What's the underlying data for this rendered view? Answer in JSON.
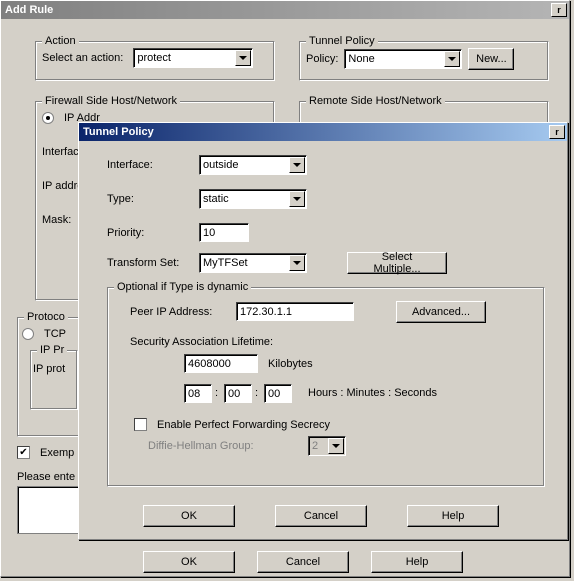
{
  "mainWindow": {
    "title": "Add Rule"
  },
  "action": {
    "legend": "Action",
    "label": "Select an action:",
    "value": "protect"
  },
  "tunnelPolicyGroup": {
    "legend": "Tunnel Policy",
    "policyLabel": "Policy:",
    "policyValue": "None",
    "newBtn": "New..."
  },
  "firewallSide": {
    "legend": "Firewall Side Host/Network",
    "ipAddrRadio": "IP Addr",
    "interfaceLabel": "Interface:",
    "ipAddressLabel": "IP addres",
    "maskLabel": "Mask:"
  },
  "remoteSide": {
    "legend": "Remote Side Host/Network"
  },
  "protocol": {
    "legend": "Protoco",
    "tcpRadio": "TCP",
    "ipprFieldset": "IP Pr",
    "ipprLabel": "IP prot"
  },
  "exemptCheck": "Exemp",
  "pleaseEnter": "Please ente",
  "mainButtons": {
    "ok": "OK",
    "cancel": "Cancel",
    "help": "Help"
  },
  "tunnelDialog": {
    "title": "Tunnel Policy",
    "interfaceLabel": "Interface:",
    "interfaceValue": "outside",
    "typeLabel": "Type:",
    "typeValue": "static",
    "priorityLabel": "Priority:",
    "priorityValue": "10",
    "transformLabel": "Transform Set:",
    "transformValue": "MyTFSet",
    "selectMultipleBtn": "Select Multiple...",
    "optionalLegend": "Optional if Type is dynamic",
    "peerIpLabel": "Peer IP Address:",
    "peerIpValue": "172.30.1.1",
    "advancedBtn": "Advanced...",
    "salLabel": "Security Association Lifetime:",
    "salBytes": "4608000",
    "kilobytesLabel": "Kilobytes",
    "hours": "08",
    "minutes": "00",
    "seconds": "00",
    "hmsLabel": "Hours : Minutes : Seconds",
    "pfsCheck": "Enable Perfect Forwarding Secrecy",
    "dhLabel": "Diffie-Hellman Group:",
    "dhValue": "2",
    "ok": "OK",
    "cancel": "Cancel",
    "help": "Help"
  }
}
